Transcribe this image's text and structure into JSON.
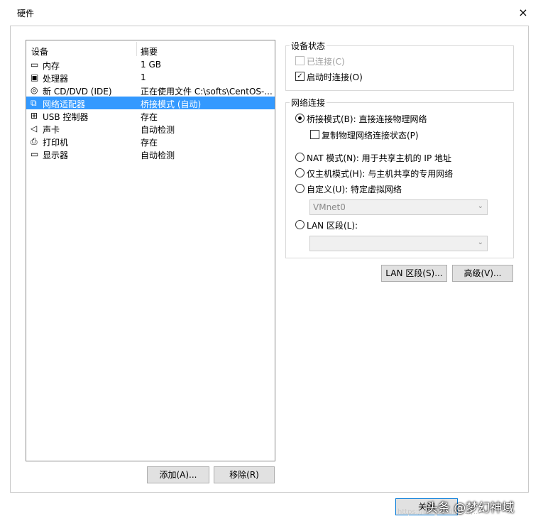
{
  "window": {
    "title": "硬件",
    "close_glyph": "×"
  },
  "devices": {
    "header": {
      "col1": "设备",
      "col2": "摘要"
    },
    "rows": [
      {
        "icon": "memory-icon",
        "glyph": "▭",
        "name": "内存",
        "summary": "1 GB",
        "selected": false
      },
      {
        "icon": "processor-icon",
        "glyph": "▣",
        "name": "处理器",
        "summary": "1",
        "selected": false
      },
      {
        "icon": "cd-dvd-icon",
        "glyph": "◎",
        "name": "新 CD/DVD (IDE)",
        "summary": "正在使用文件 C:\\softs\\CentOS-...",
        "selected": false
      },
      {
        "icon": "network-adapter-icon",
        "glyph": "⧉",
        "name": "网络适配器",
        "summary": "桥接模式 (自动)",
        "selected": true
      },
      {
        "icon": "usb-icon",
        "glyph": "⊞",
        "name": "USB 控制器",
        "summary": "存在",
        "selected": false
      },
      {
        "icon": "sound-card-icon",
        "glyph": "◁",
        "name": "声卡",
        "summary": "自动检测",
        "selected": false
      },
      {
        "icon": "printer-icon",
        "glyph": "⎙",
        "name": "打印机",
        "summary": "存在",
        "selected": false
      },
      {
        "icon": "display-icon",
        "glyph": "▭",
        "name": "显示器",
        "summary": "自动检测",
        "selected": false
      }
    ],
    "add_label": "添加(A)...",
    "remove_label": "移除(R)"
  },
  "device_status": {
    "label": "设备状态",
    "connected": {
      "label": "已连接(C)",
      "checked": false,
      "disabled": true
    },
    "connect_at_power_on": {
      "label": "启动时连接(O)",
      "checked": true
    }
  },
  "network_connection": {
    "label": "网络连接",
    "bridged": {
      "label": "桥接模式(B): 直接连接物理网络",
      "selected": true
    },
    "replicate": {
      "label": "复制物理网络连接状态(P)",
      "checked": false
    },
    "nat": {
      "label": "NAT 模式(N): 用于共享主机的 IP 地址",
      "selected": false
    },
    "host_only": {
      "label": "仅主机模式(H): 与主机共享的专用网络",
      "selected": false
    },
    "custom": {
      "label": "自定义(U): 特定虚拟网络",
      "selected": false
    },
    "custom_value": "VMnet0",
    "lan_segment": {
      "label": "LAN 区段(L):",
      "selected": false
    },
    "lan_segment_value": ""
  },
  "buttons": {
    "lan_segments": "LAN 区段(S)...",
    "advanced": "高级(V)...",
    "close": "关闭"
  },
  "watermark": {
    "text": "头条 @梦幻神域",
    "url": "https://blog.csdn.net/..."
  }
}
